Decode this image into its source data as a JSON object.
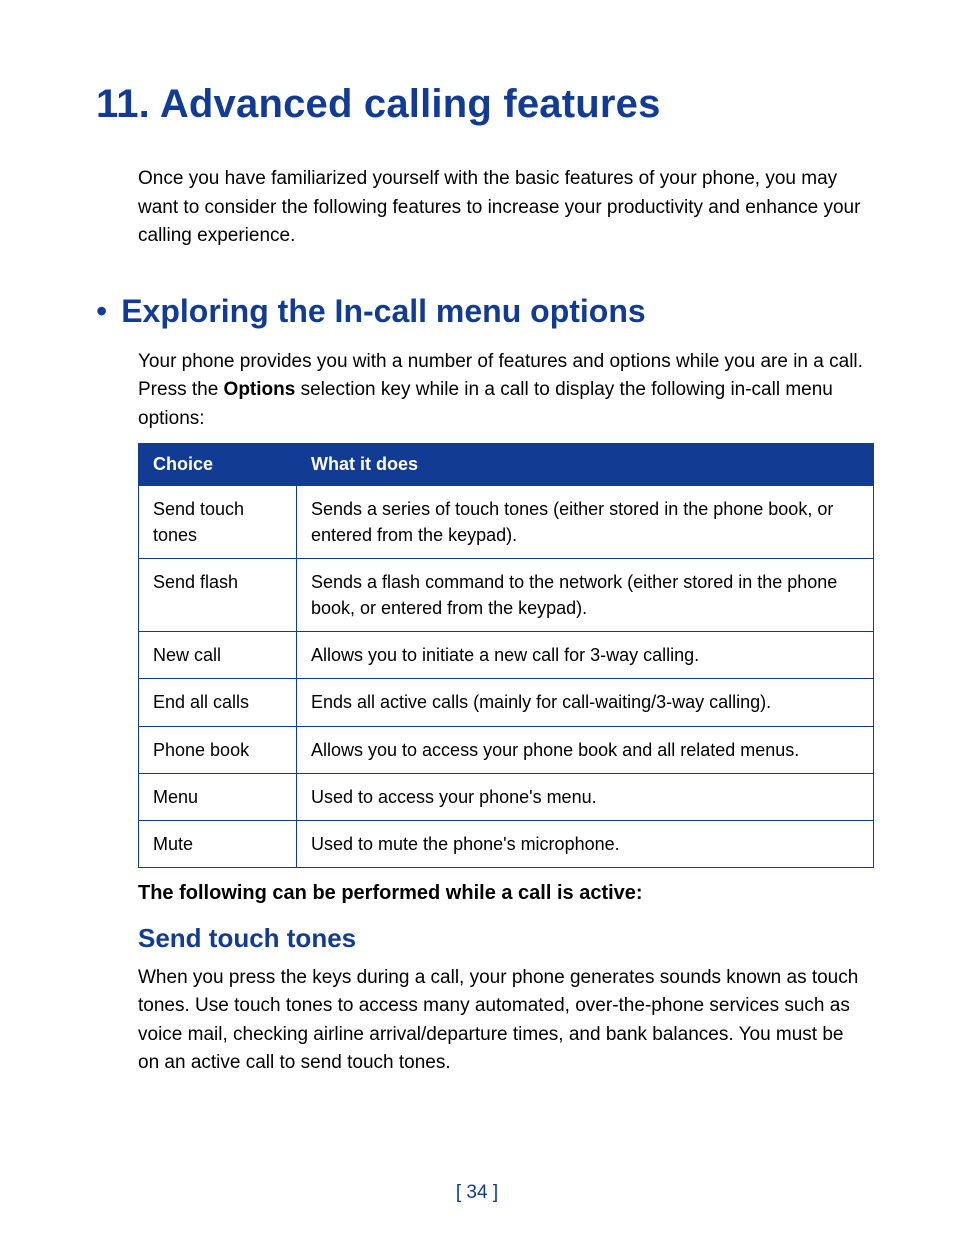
{
  "chapter": {
    "title": "11. Advanced calling features"
  },
  "intro": "Once you have familiarized yourself with the basic features of your phone, you may want to consider the following features to increase your productivity and enhance your calling experience.",
  "section": {
    "bullet": "•",
    "title": "Exploring the In-call menu options",
    "lead_before": "Your phone provides you with a number of features and options while you are in a call. Press the ",
    "lead_bold": "Options",
    "lead_after": " selection key while in a call to display the following in-call menu options:"
  },
  "table": {
    "headers": {
      "col1": "Choice",
      "col2": "What it does"
    },
    "rows": [
      {
        "choice": "Send touch tones",
        "desc": "Sends a series of touch tones (either stored in the phone book, or entered from the keypad)."
      },
      {
        "choice": "Send flash",
        "desc": "Sends a flash command to the network (either stored in the phone book, or entered from the keypad)."
      },
      {
        "choice": "New call",
        "desc": "Allows you to initiate a new call for 3-way calling."
      },
      {
        "choice": "End all calls",
        "desc": "Ends all active calls (mainly for call-waiting/3-way calling)."
      },
      {
        "choice": "Phone book",
        "desc": "Allows you to access your phone book and all related menus."
      },
      {
        "choice": "Menu",
        "desc": "Used to access your phone's menu."
      },
      {
        "choice": "Mute",
        "desc": "Used to mute the phone's microphone."
      }
    ]
  },
  "subheading": "The following can be performed while a call is active:",
  "h3": {
    "title": "Send touch tones"
  },
  "h3_body": "When you press the keys during a call, your phone generates sounds known as touch tones. Use touch tones to access many automated, over-the-phone services such as voice mail, checking airline arrival/departure times, and bank balances. You must be on an active call to send touch tones.",
  "page_num": "[ 34 ]"
}
